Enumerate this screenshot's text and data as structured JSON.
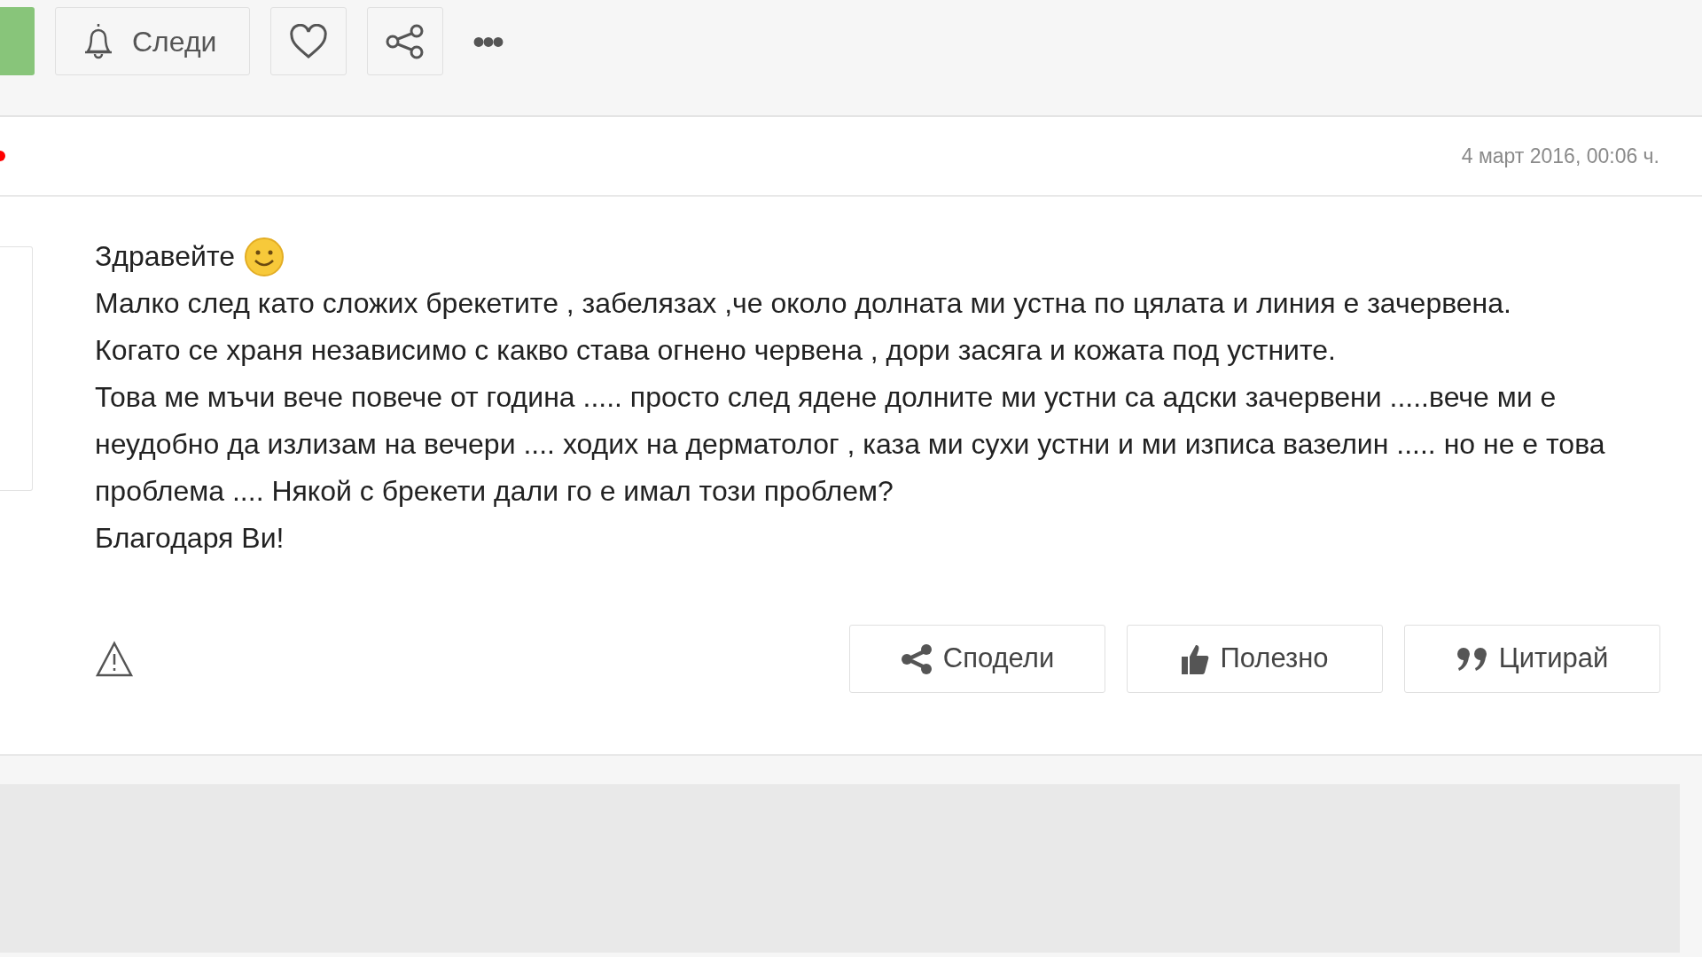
{
  "toolbar": {
    "follow_button": "Следи",
    "more_button": "•••"
  },
  "post": {
    "date": "4 март 2016, 00:06 ч.",
    "greeting": "Здравейте",
    "paragraphs": [
      "Малко след като сложих брекетите , забелязах ,че около долната ми устна по цялата и линия е зачервена.",
      "Когато се храня независимо с какво става огнено червена , дори засяга и кожата под устните.",
      "Това ме мъчи вече повече от година ..... просто след ядене долните ми устни са адски зачервени .....вече ми е неудобно да излизам на вечери .... ходих на дерматолог , каза ми сухи устни и ми изписа вазелин ..... но не е това проблема .... Някой с брекети дали го е имал този проблем?",
      "Благодаря Ви!"
    ],
    "actions": [
      {
        "kind": "share",
        "label": "Сподели"
      },
      {
        "kind": "like",
        "label": "Полезно"
      },
      {
        "kind": "quote",
        "label": "Цитирай"
      }
    ]
  }
}
